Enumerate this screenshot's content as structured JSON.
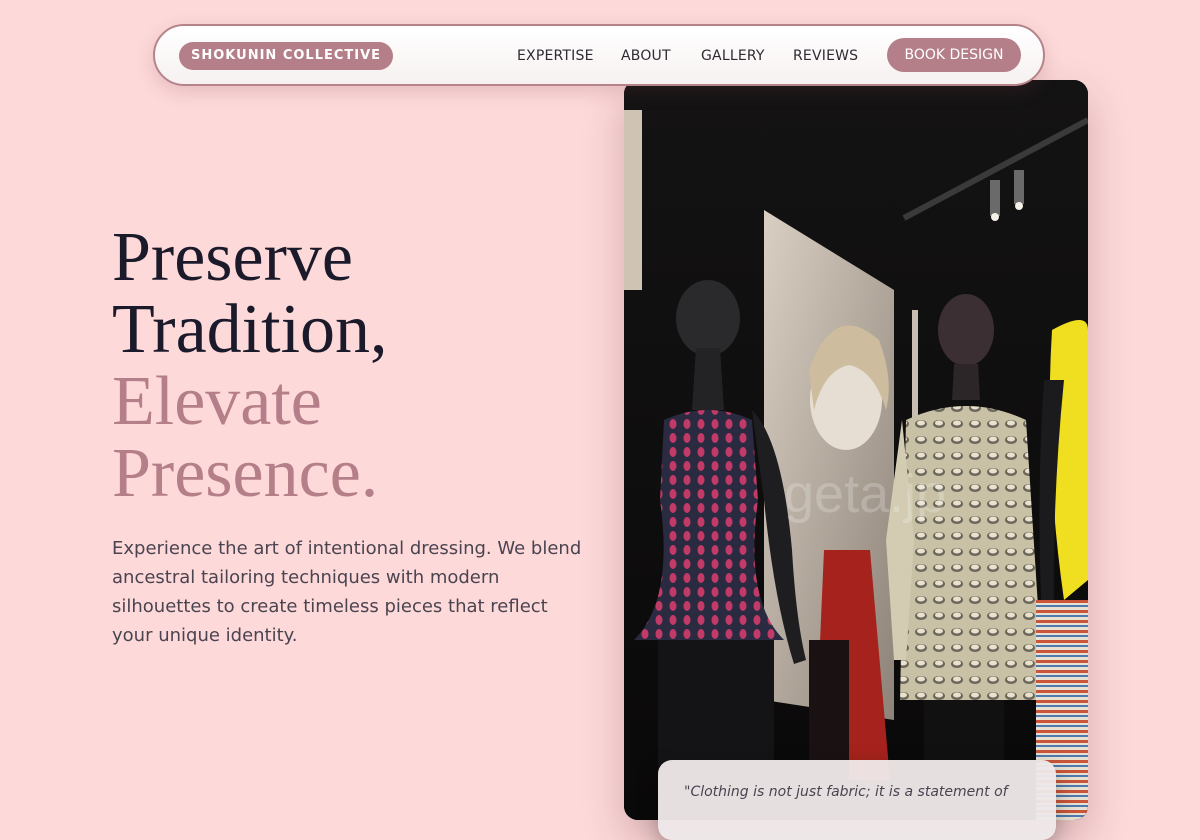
{
  "nav": {
    "brand": "SHOKUNIN COLLECTIVE",
    "links": [
      "EXPERTISE",
      "ABOUT",
      "GALLERY",
      "REVIEWS"
    ],
    "cta": "BOOK DESIGN"
  },
  "hero": {
    "headline_line1": "Preserve",
    "headline_line2": "Tradition,",
    "accent_line1": "Elevate",
    "accent_line2": "Presence.",
    "lead": "Experience the art of intentional dressing. We blend ancestral tailoring techniques with modern silhouettes to create timeless pieces that reflect your unique identity."
  },
  "gallery": {
    "watermark": "geta.jp",
    "quote": "\"Clothing is not just fabric; it is a statement of"
  },
  "colors": {
    "background": "#fdd9d9",
    "accent": "#b47f88",
    "headline": "#1b1a2b"
  }
}
